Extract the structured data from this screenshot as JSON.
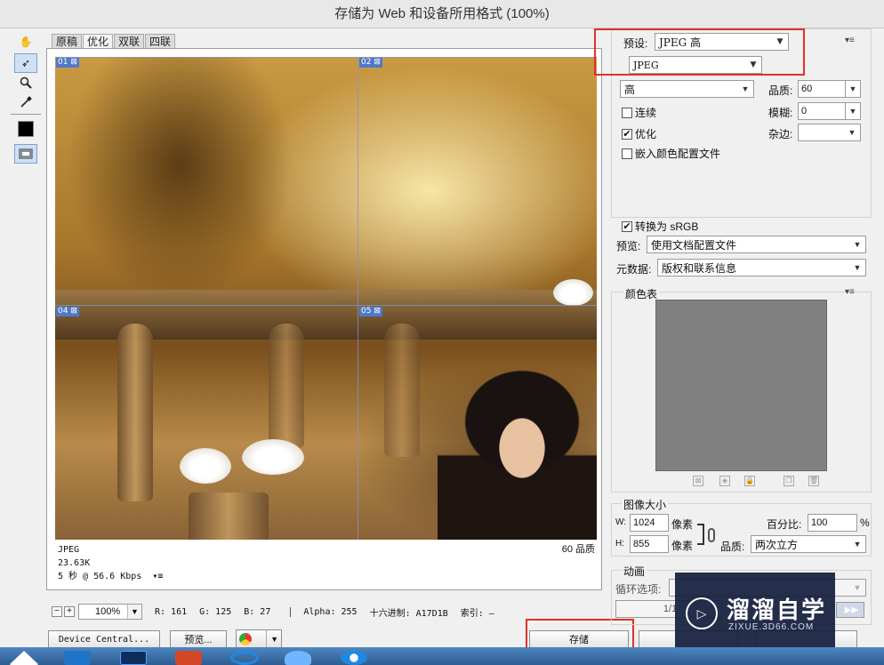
{
  "window": {
    "title": "存储为 Web 和设备所用格式 (100%)"
  },
  "tools": [
    {
      "name": "hand-tool-icon",
      "glyph": "✋"
    },
    {
      "name": "slice-select-tool-icon",
      "glyph": "➶"
    },
    {
      "name": "zoom-tool-icon",
      "glyph": "🔍"
    },
    {
      "name": "eyedropper-tool-icon",
      "glyph": "✎"
    }
  ],
  "tabs": [
    "原稿",
    "优化",
    "双联",
    "四联"
  ],
  "active_tab": "优化",
  "slices": [
    "01",
    "02",
    "04",
    "05"
  ],
  "image_info": {
    "format": "JPEG",
    "size": "23.63K",
    "time": "5 秒 @ 56.6 Kbps",
    "menu_glyph": "▾≡",
    "quality": "60 品质"
  },
  "status": {
    "zoom": "100%",
    "r": "R: 161",
    "g": "G: 125",
    "b": "B: 27",
    "alpha": "Alpha: 255",
    "hex": "十六进制: A17D1B",
    "index": "索引: —"
  },
  "bottom_buttons": {
    "device_central": "Device Central...",
    "preview": "预览...",
    "save": "存储"
  },
  "settings": {
    "preset_label": "预设:",
    "preset_value": "JPEG 高",
    "format_value": "JPEG",
    "compression_value": "高",
    "quality_label": "品质:",
    "quality_value": "60",
    "progressive_label": "连续",
    "progressive_checked": false,
    "blur_label": "模糊:",
    "blur_value": "0",
    "optimized_label": "优化",
    "optimized_checked": true,
    "matte_label": "杂边:",
    "matte_value": "",
    "embed_profile_label": "嵌入颜色配置文件",
    "embed_profile_checked": false,
    "convert_srgb_label": "转换为 sRGB",
    "convert_srgb_checked": true,
    "preview_label": "预览:",
    "preview_value": "使用文档配置文件",
    "metadata_label": "元数据:",
    "metadata_value": "版权和联系信息"
  },
  "color_table": {
    "title": "颜色表",
    "color": "#808080"
  },
  "image_size": {
    "title": "图像大小",
    "w_label": "W:",
    "w_value": "1024",
    "h_label": "H:",
    "h_value": "855",
    "unit": "像素",
    "percent_label": "百分比:",
    "percent_value": "100",
    "percent_unit": "%",
    "quality_label": "品质:",
    "quality_value": "两次立方"
  },
  "animation": {
    "title": "动画",
    "loop_label": "循环选项:",
    "frame_counter": "1/1"
  },
  "watermark": {
    "brand": "溜溜自学",
    "url": "ZIXUE.3D66.COM"
  },
  "highlight_color": "#e03030"
}
